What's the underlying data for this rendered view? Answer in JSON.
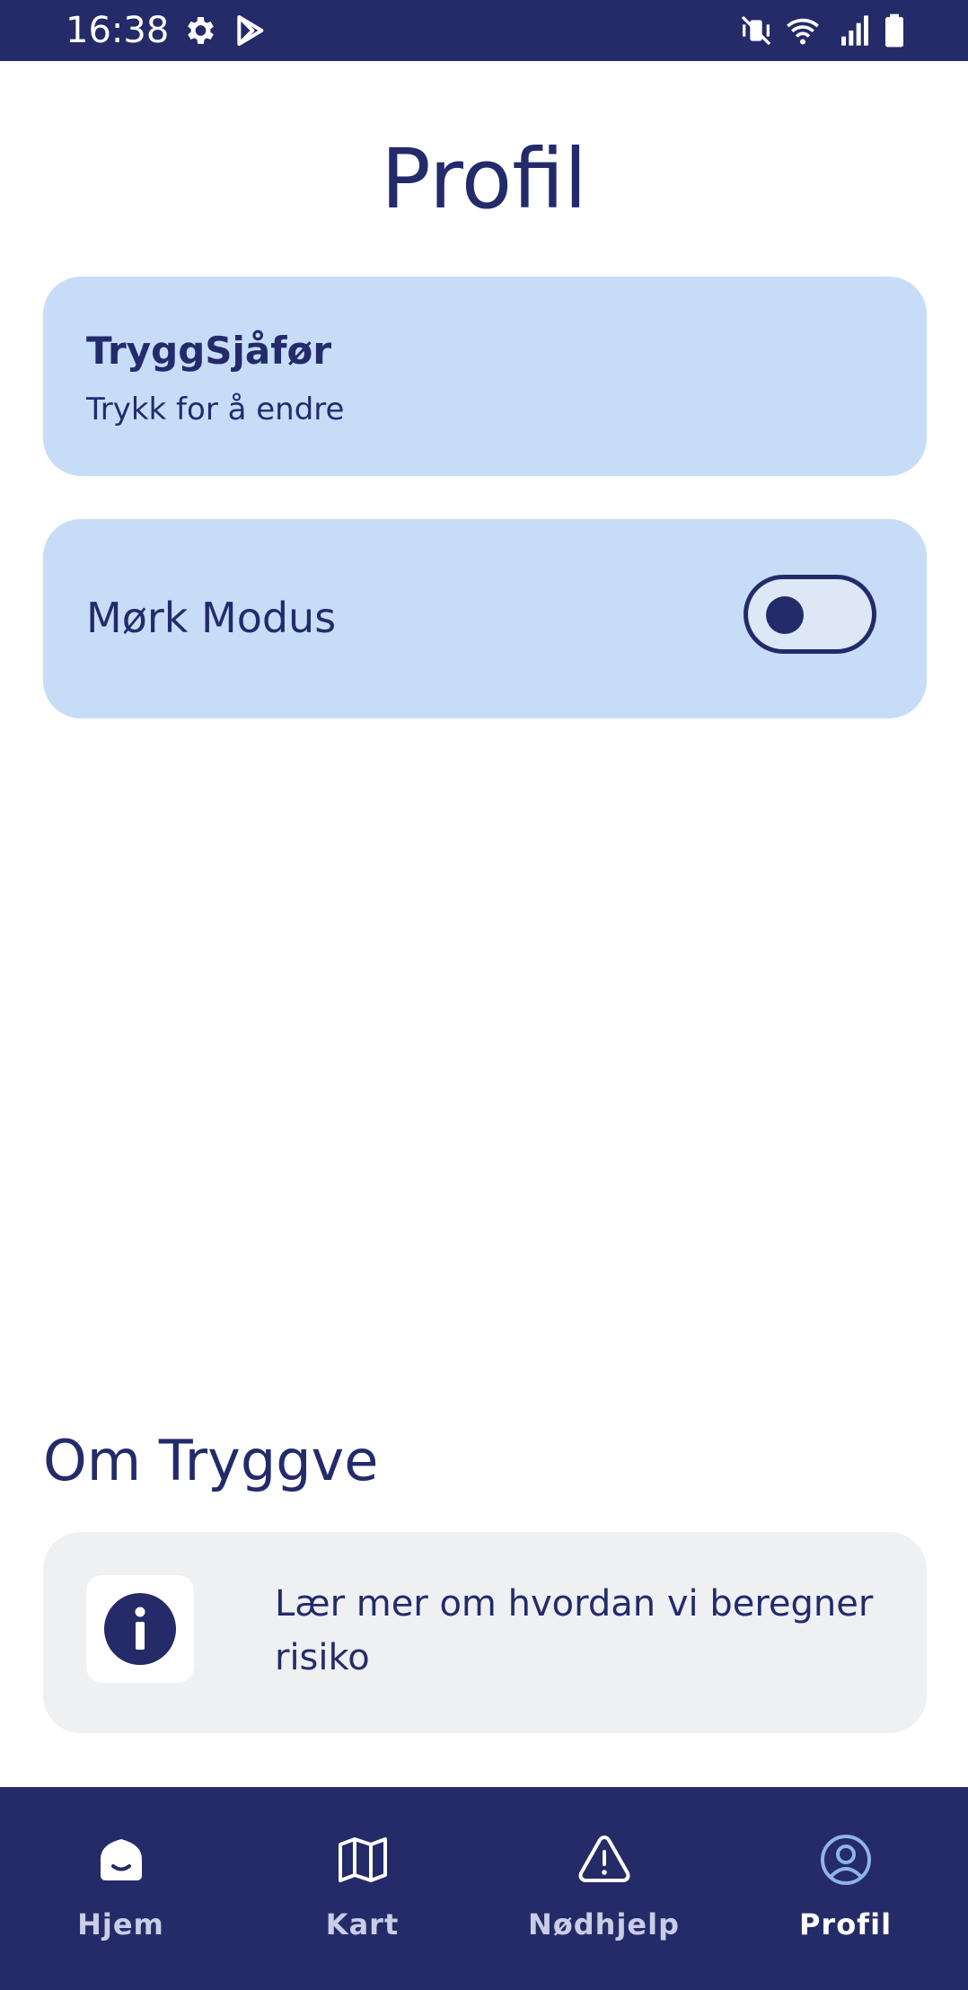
{
  "status_bar": {
    "time": "16:38",
    "icons": [
      "gear-icon",
      "play-store-icon",
      "mute-vibrate-icon",
      "wifi-icon",
      "signal-icon",
      "battery-icon"
    ]
  },
  "page": {
    "title": "Profil"
  },
  "profile_card": {
    "name": "TryggSjåfør",
    "subtitle": "Trykk for å endre"
  },
  "dark_mode": {
    "label": "Mørk Modus",
    "enabled": false
  },
  "about": {
    "title": "Om Tryggve",
    "info_card_text": "Lær mer om hvordan vi beregner risiko",
    "icon": "info-icon"
  },
  "bottom_nav": {
    "items": [
      {
        "label": "Hjem",
        "icon": "home-icon",
        "active": false
      },
      {
        "label": "Kart",
        "icon": "map-icon",
        "active": false
      },
      {
        "label": "Nødhjelp",
        "icon": "warning-icon",
        "active": false
      },
      {
        "label": "Profil",
        "icon": "profile-icon",
        "active": true
      }
    ]
  },
  "colors": {
    "primary": "#242b68",
    "card_bg": "#c7ddf7",
    "info_card_bg": "#eef0f2",
    "active_icon": "#8fb4ec"
  }
}
